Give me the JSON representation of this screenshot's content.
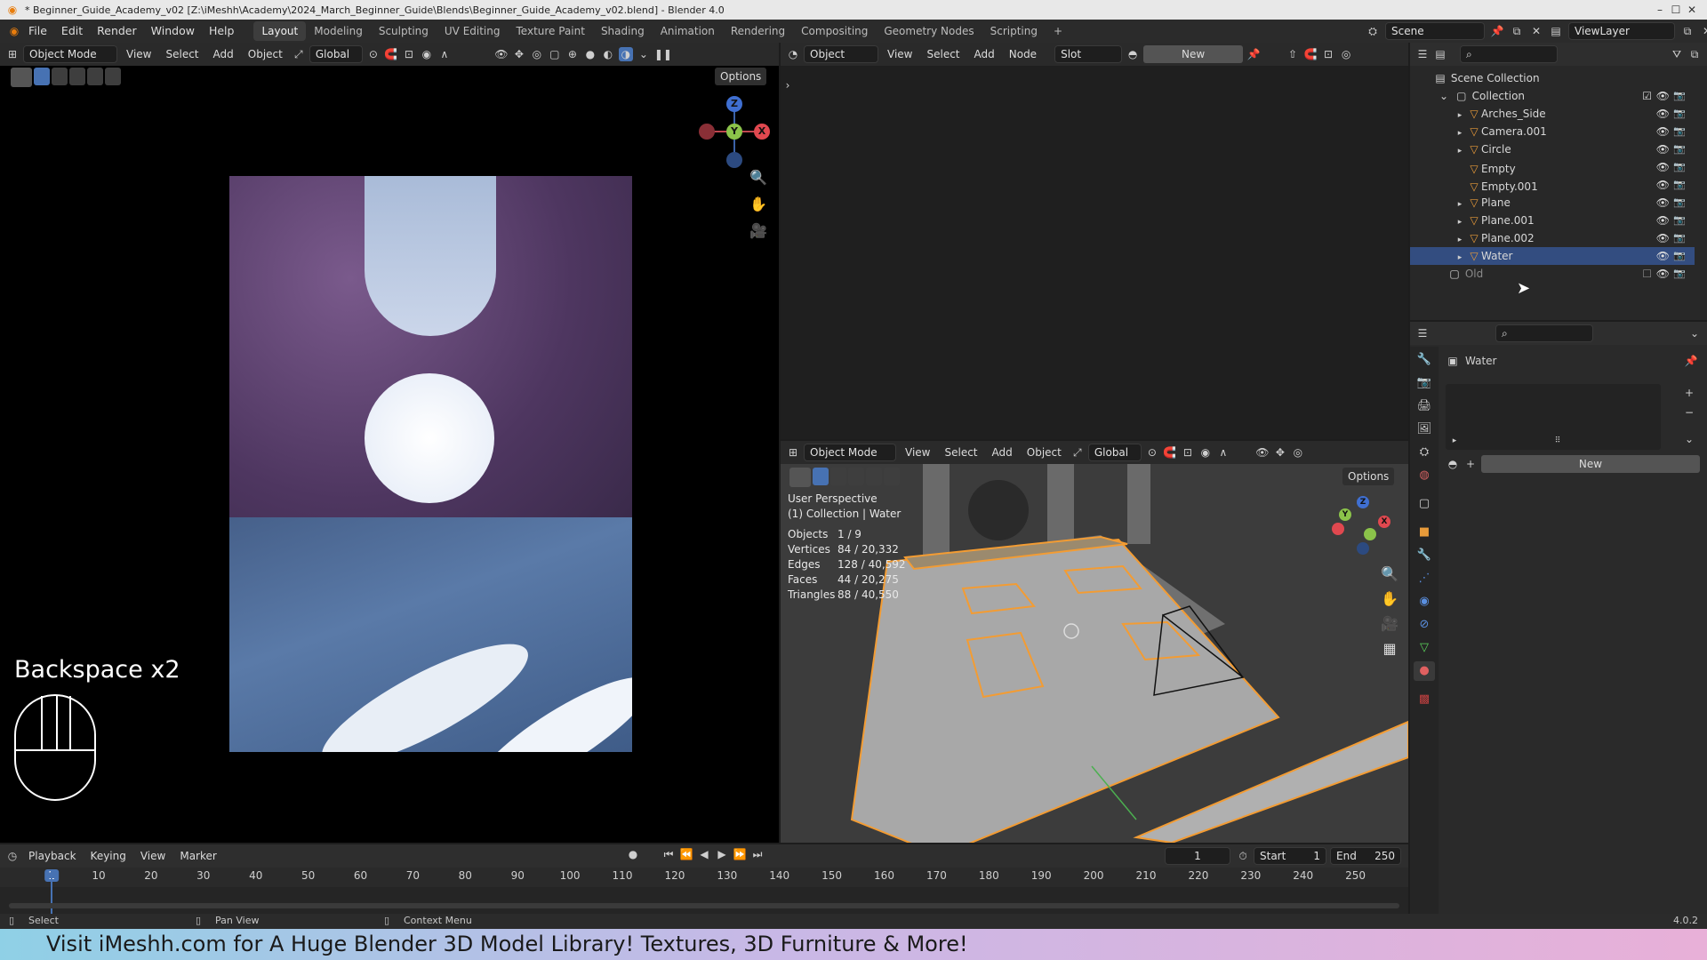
{
  "window": {
    "title": "* Beginner_Guide_Academy_v02 [Z:\\iMeshh\\Academy\\2024_March_Beginner_Guide\\Blends\\Beginner_Guide_Academy_v02.blend] - Blender 4.0",
    "minimize": "–",
    "maximize": "☐",
    "close": "✕"
  },
  "menubar": {
    "items": [
      "File",
      "Edit",
      "Render",
      "Window",
      "Help"
    ],
    "workspaces": [
      "Layout",
      "Modeling",
      "Sculpting",
      "UV Editing",
      "Texture Paint",
      "Shading",
      "Animation",
      "Rendering",
      "Compositing",
      "Geometry Nodes",
      "Scripting"
    ],
    "active_workspace": "Layout",
    "add_tab": "+",
    "scene": "Scene",
    "view_layer": "ViewLayer"
  },
  "left_viewport": {
    "mode": "Object Mode",
    "menus": [
      "View",
      "Select",
      "Add",
      "Object"
    ],
    "orientation": "Global",
    "options": "Options",
    "overlay_text": "Backspace x2",
    "gizmo": {
      "z": "Z",
      "y": "Y",
      "x": "X"
    }
  },
  "shader_editor": {
    "type": "Object",
    "menus": [
      "View",
      "Select",
      "Add",
      "Node"
    ],
    "slot": "Slot",
    "new_label": "New"
  },
  "right_viewport": {
    "mode": "Object Mode",
    "menus": [
      "View",
      "Select",
      "Add",
      "Object"
    ],
    "orientation": "Global",
    "options": "Options",
    "perspective": "User Perspective",
    "context": "(1) Collection | Water",
    "stats": [
      {
        "label": "Objects",
        "value": "1 / 9"
      },
      {
        "label": "Vertices",
        "value": "84 / 20,332"
      },
      {
        "label": "Edges",
        "value": "128 / 40,592"
      },
      {
        "label": "Faces",
        "value": "44 / 20,275"
      },
      {
        "label": "Triangles",
        "value": "88 / 40,550"
      }
    ]
  },
  "outliner": {
    "root": "Scene Collection",
    "collection": "Collection",
    "items": [
      {
        "name": "Arches_Side",
        "expand": true,
        "selected": false
      },
      {
        "name": "Camera.001",
        "expand": true,
        "selected": false
      },
      {
        "name": "Circle",
        "expand": true,
        "selected": false
      },
      {
        "name": "Empty",
        "expand": false,
        "selected": false
      },
      {
        "name": "Empty.001",
        "expand": false,
        "selected": false
      },
      {
        "name": "Plane",
        "expand": true,
        "selected": false
      },
      {
        "name": "Plane.001",
        "expand": true,
        "selected": false
      },
      {
        "name": "Plane.002",
        "expand": true,
        "selected": false
      },
      {
        "name": "Water",
        "expand": true,
        "selected": true
      }
    ],
    "old_collection": "Old"
  },
  "properties": {
    "object_name": "Water",
    "new_label": "New"
  },
  "timeline": {
    "menus": [
      "Playback",
      "Keying",
      "View",
      "Marker"
    ],
    "current_frame": "1",
    "start_label": "Start",
    "start": "1",
    "end_label": "End",
    "end": "250",
    "ticks": [
      "1",
      "10",
      "20",
      "30",
      "40",
      "50",
      "60",
      "70",
      "80",
      "90",
      "100",
      "110",
      "120",
      "130",
      "140",
      "150",
      "160",
      "170",
      "180",
      "190",
      "200",
      "210",
      "220",
      "230",
      "240",
      "250"
    ]
  },
  "statusbar": {
    "select": "Select",
    "pan": "Pan View",
    "context": "Context Menu",
    "version": "4.0.2"
  },
  "banner": "Visit iMeshh.com for A Huge Blender 3D Model Library! Textures, 3D Furniture & More!"
}
